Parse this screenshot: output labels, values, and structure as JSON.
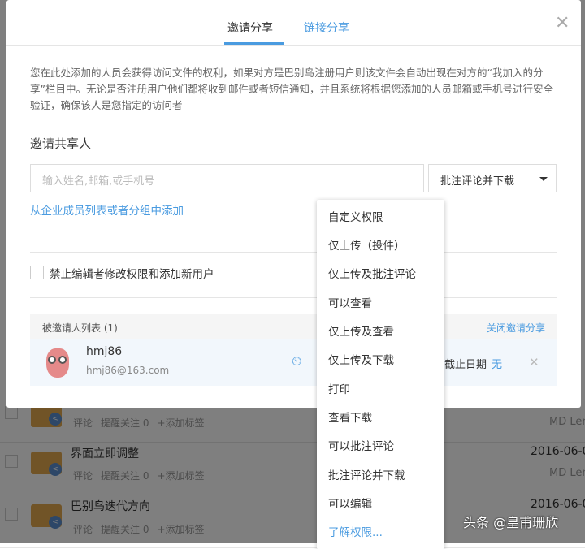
{
  "modal": {
    "tabs": [
      {
        "label": "邀请分享",
        "active": true
      },
      {
        "label": "链接分享",
        "active": false
      }
    ],
    "description": "您在此处添加的人员会获得访问文件的权利，如果对方是巴别鸟注册用户则该文件会自动出现在对方的“我加入的分享”栏目中。无论是否注册用户他们都将收到邮件或者短信通知，并且系统将根据您添加的人员邮箱或手机号进行安全验证，确保该人是您指定的访问者",
    "invite_heading": "邀请共享人",
    "input_placeholder": "输入姓名,邮箱,或手机号",
    "permission_selected": "批注评论并下载",
    "add_from_org": "从企业成员列表或者分组中添加",
    "restrict_label": "禁止编辑者修改权限和添加新用户",
    "list_header": "被邀请人列表 (1)",
    "close_share": "关闭邀请分享",
    "invitee": {
      "name": "hmj86",
      "email": "hmj86@163.com",
      "expiry_label": "截止日期",
      "expiry_value": "无"
    }
  },
  "dropdown": [
    "自定义权限",
    "仅上传（投件）",
    "仅上传及批注评论",
    "可以查看",
    "仅上传及查看",
    "仅上传及下载",
    "打印",
    "查看下载",
    "可以批注评论",
    "批注评论并下载",
    "可以编辑"
  ],
  "dropdown_learn": "了解权限...",
  "background": {
    "actions": {
      "comment": "评论",
      "remind": "提醒关注 0",
      "tag": "+添加标签"
    },
    "rows": [
      {
        "title": "",
        "date": "",
        "owner": "MD Len"
      },
      {
        "title": "界面立即调整",
        "date": "2016-06-0",
        "owner": "MD Len"
      },
      {
        "title": "巴别鸟迭代方向",
        "date": "2016-06-0",
        "owner": ""
      }
    ]
  },
  "watermark": "头条 @皇甫珊欣",
  "colors": {
    "accent": "#4a9be0",
    "folder": "#e2a94e"
  }
}
